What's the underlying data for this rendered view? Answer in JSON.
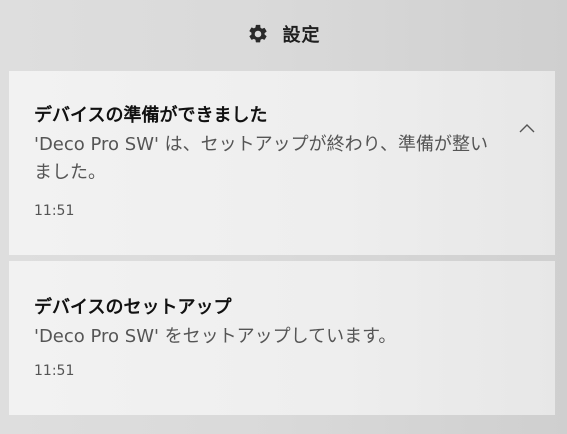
{
  "header": {
    "title": "設定",
    "icon": "gear-icon"
  },
  "notifications": [
    {
      "title": "デバイスの準備ができました",
      "body": "'Deco Pro SW' は、セットアップが終わり、準備が整いました。",
      "time": "11:51",
      "expand_icon": "chevron-up-icon"
    },
    {
      "title": "デバイスのセットアップ",
      "body": "'Deco Pro SW' をセットアップしています。",
      "time": "11:51"
    }
  ]
}
